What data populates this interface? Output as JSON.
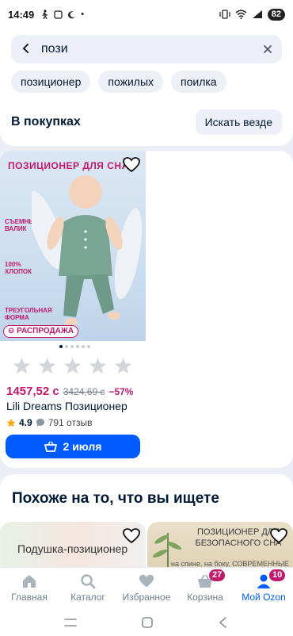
{
  "status": {
    "time": "14:49",
    "battery": "82"
  },
  "search": {
    "query": "пози",
    "back_icon": "arrow-left-icon",
    "clear_icon": "close-icon"
  },
  "suggestions": [
    "позиционер",
    "пожилых",
    "поилка"
  ],
  "purchases": {
    "title": "В покупках",
    "search_all": "Искать везде"
  },
  "product": {
    "image_title": "ПОЗИЦИОНЕР ДЛЯ СНА",
    "image_labels": [
      "СЪЕМНЫЙ ВАЛИК",
      "100% ХЛОПОК",
      "ТРЕУГОЛЬНАЯ ФОРМА"
    ],
    "sale_badge": "РАСПРОДАЖА",
    "image_count": 6,
    "current_image": 1,
    "stars": 5,
    "price": "1457,52 с",
    "old_price": "3424,69 с",
    "discount": "−57%",
    "name": "Lili Dreams Позиционер",
    "rating": "4.9",
    "reviews": "791 отзыв",
    "delivery": "2 июля"
  },
  "similar": {
    "title": "Похоже на то, что вы ищете",
    "card1_text": "Подушка-позиционер",
    "card2_text": "ПОЗИЦИОНЕР ДЛЯ БЕЗОПАСНОГО СНА",
    "card2_sub": "на спине, на боку, СОВРЕМЕННЫЕ МЯГКИЕ ЛИПУЧКИ"
  },
  "tabs": [
    {
      "label": "Главная",
      "icon": "home-icon"
    },
    {
      "label": "Каталог",
      "icon": "search-icon"
    },
    {
      "label": "Избранное",
      "icon": "heart-icon"
    },
    {
      "label": "Корзина",
      "icon": "basket-icon",
      "badge": "27"
    },
    {
      "label": "Мой Ozon",
      "icon": "profile-icon",
      "badge": "10",
      "active": true
    }
  ],
  "colors": {
    "accent": "#005bff",
    "sale": "#c2186c",
    "background": "#ebeff5"
  }
}
